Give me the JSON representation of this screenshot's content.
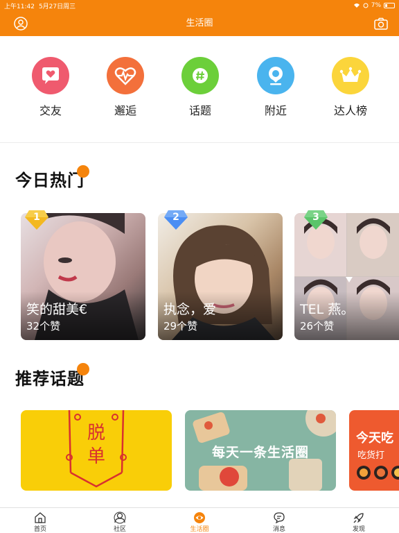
{
  "status_bar": {
    "time": "上午11:42",
    "date": "5月27日周三",
    "battery": "7%"
  },
  "nav": {
    "title": "生活圈",
    "avatar_icon": "user-icon",
    "camera_icon": "camera-icon"
  },
  "categories": [
    {
      "label": "交友",
      "icon": "heart-chat-icon",
      "color": "#ef5a6e"
    },
    {
      "label": "邂逅",
      "icon": "heartbeat-icon",
      "color": "#f3703b"
    },
    {
      "label": "话题",
      "icon": "hashtag-icon",
      "color": "#6ccf3a"
    },
    {
      "label": "附近",
      "icon": "location-icon",
      "color": "#4ab4ee"
    },
    {
      "label": "达人榜",
      "icon": "crown-icon",
      "color": "#fbd53b"
    }
  ],
  "hot": {
    "title": "今日热门",
    "items": [
      {
        "rank": "1",
        "name": "笑的甜美€",
        "likes": "32个赞",
        "badge_color": "#f3b820"
      },
      {
        "rank": "2",
        "name": "执念，爱",
        "likes": "29个赞",
        "badge_color": "#4b8ef3"
      },
      {
        "rank": "3",
        "name": "TEL 燕。",
        "likes": "26个赞",
        "badge_color": "#5bc46a"
      }
    ]
  },
  "topics": {
    "title": "推荐话题",
    "items": [
      {
        "text": "脱单",
        "bg": "#f9ce08"
      },
      {
        "text": "每天一条生活圈",
        "bg": "#86b5a3"
      },
      {
        "text": "今天吃",
        "subtext": "吃货打",
        "bg": "#ee5a2f"
      }
    ]
  },
  "tabs": [
    {
      "label": "首页",
      "icon": "home-icon"
    },
    {
      "label": "社区",
      "icon": "community-icon"
    },
    {
      "label": "生活圈",
      "icon": "eye-icon",
      "active": true
    },
    {
      "label": "消息",
      "icon": "message-icon"
    },
    {
      "label": "发现",
      "icon": "rocket-icon"
    }
  ],
  "accent_color": "#f5840c"
}
